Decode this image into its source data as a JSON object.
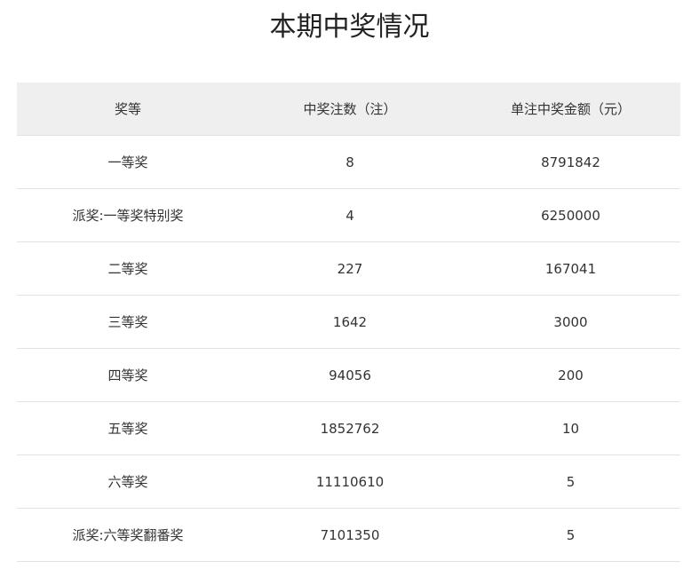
{
  "page": {
    "title": "本期中奖情况"
  },
  "table": {
    "columns": [
      "奖等",
      "中奖注数（注）",
      "单注中奖金额（元）"
    ],
    "rows": [
      {
        "level": "一等奖",
        "count": "8",
        "amount": "8791842"
      },
      {
        "level": "派奖:一等奖特别奖",
        "count": "4",
        "amount": "6250000"
      },
      {
        "level": "二等奖",
        "count": "227",
        "amount": "167041"
      },
      {
        "level": "三等奖",
        "count": "1642",
        "amount": "3000"
      },
      {
        "level": "四等奖",
        "count": "94056",
        "amount": "200"
      },
      {
        "level": "五等奖",
        "count": "1852762",
        "amount": "10"
      },
      {
        "level": "六等奖",
        "count": "11110610",
        "amount": "5"
      },
      {
        "level": "派奖:六等奖翻番奖",
        "count": "7101350",
        "amount": "5"
      }
    ]
  }
}
